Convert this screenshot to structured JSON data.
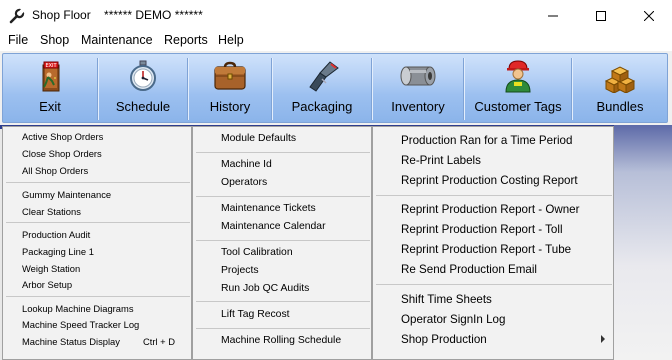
{
  "window": {
    "title": "Shop Floor    ****** DEMO ******",
    "icon": "wrench-icon",
    "controls": [
      "minimize",
      "maximize",
      "close"
    ]
  },
  "menubar": [
    "File",
    "Shop",
    "Maintenance",
    "Reports",
    "Help"
  ],
  "toolbar": [
    {
      "label": "Exit",
      "icon": "exit-door-icon"
    },
    {
      "label": "Schedule",
      "icon": "stopwatch-icon"
    },
    {
      "label": "History",
      "icon": "briefcase-icon"
    },
    {
      "label": "Packaging",
      "icon": "barcode-scanner-icon"
    },
    {
      "label": "Inventory",
      "icon": "steel-coil-icon"
    },
    {
      "label": "Customer Tags",
      "icon": "worker-icon"
    },
    {
      "label": "Bundles",
      "icon": "boxes-icon"
    }
  ],
  "shop_menu": {
    "groups": [
      [
        "Active Shop Orders",
        "Close Shop Orders",
        "All Shop Orders"
      ],
      [
        "Gummy Maintenance",
        "Clear Stations"
      ],
      [
        "Production Audit",
        "Packaging Line 1",
        "Weigh Station",
        "Arbor Setup"
      ],
      [
        "Lookup Machine Diagrams",
        "Machine Speed Tracker Log",
        "Machine Status Display"
      ]
    ],
    "shortcut": "Ctrl + D"
  },
  "maintenance_menu": {
    "groups": [
      [
        "Module Defaults"
      ],
      [
        "Machine Id",
        "Operators"
      ],
      [
        "Maintenance Tickets",
        "Maintenance Calendar"
      ],
      [
        "Tool Calibration",
        "Projects",
        "Run Job QC Audits"
      ],
      [
        "Lift Tag Recost"
      ],
      [
        "Machine Rolling Schedule"
      ]
    ]
  },
  "reports_menu": {
    "groups": [
      [
        "Production Ran for a Time Period",
        "Re-Print Labels",
        "Reprint Production Costing Report"
      ],
      [
        "Reprint Production Report - Owner",
        "Reprint Production Report - Toll",
        "Reprint Production Report - Tube",
        "Re Send Production Email"
      ],
      [
        "Shift Time Sheets",
        "Operator SignIn Log",
        "Shop Production"
      ]
    ]
  }
}
